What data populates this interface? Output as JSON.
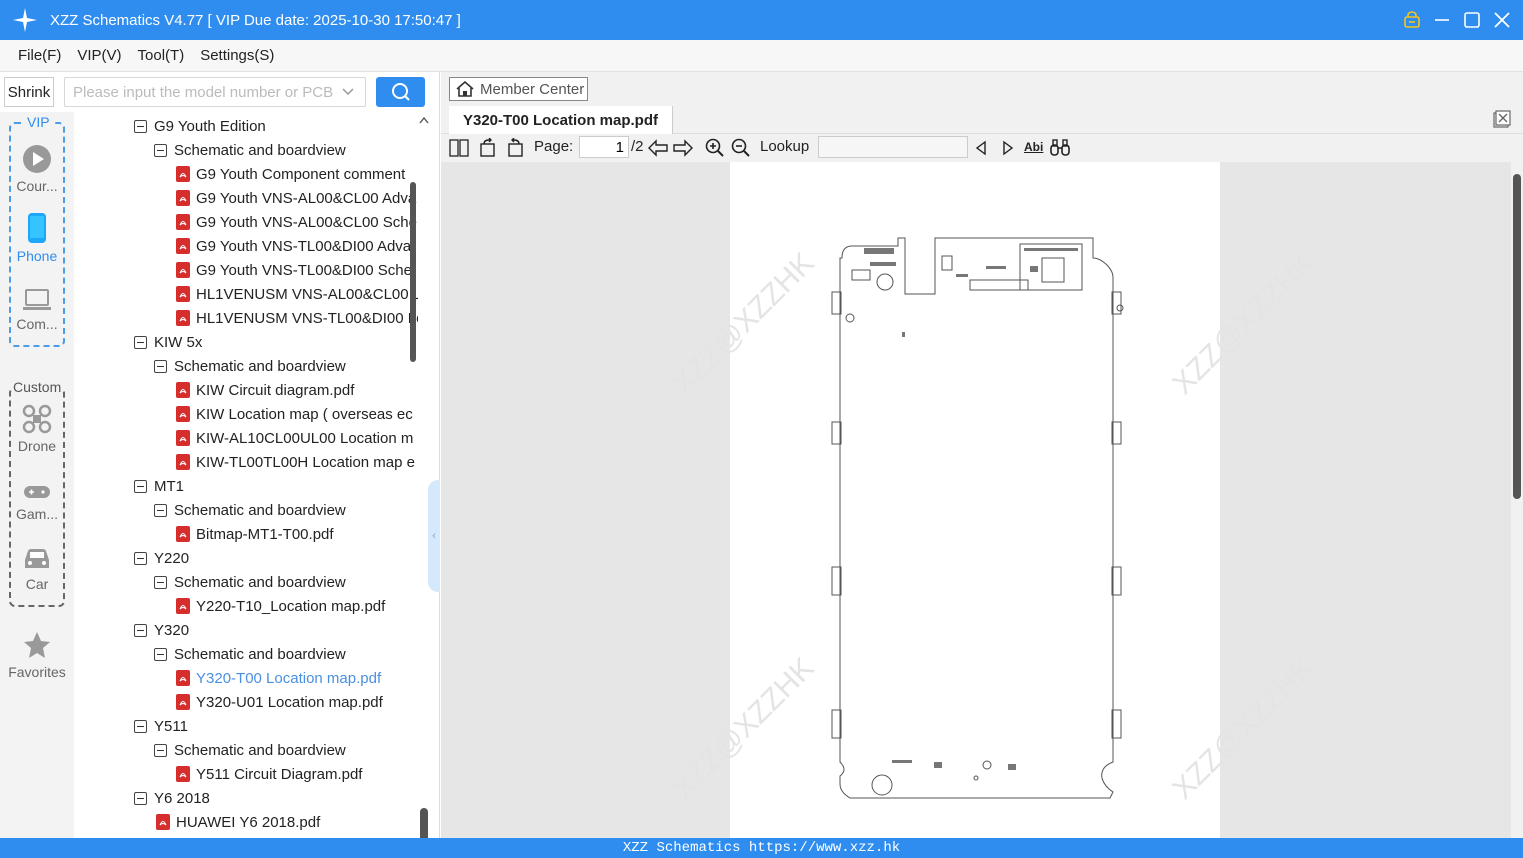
{
  "window": {
    "title": "XZZ Schematics V4.77 [ VIP Due date: 2025-10-30 17:50:47 ]",
    "icons": [
      "logo-icon",
      "lock-icon",
      "minimize-icon",
      "maximize-icon",
      "close-icon"
    ]
  },
  "menu": [
    "File(F)",
    "VIP(V)",
    "Tool(T)",
    "Settings(S)"
  ],
  "search": {
    "shrink_label": "Shrink",
    "placeholder": "Please input the model number or PCB"
  },
  "sidebar": {
    "vip_label": "VIP",
    "custom_label": "Custom",
    "items": [
      {
        "label": "Cour...",
        "icon": "play-icon"
      },
      {
        "label": "Phone",
        "icon": "phone-icon",
        "active": true
      },
      {
        "label": "Com...",
        "icon": "laptop-icon"
      },
      {
        "label": "Drone",
        "icon": "drone-icon"
      },
      {
        "label": "Gam...",
        "icon": "gamepad-icon"
      },
      {
        "label": "Car",
        "icon": "car-icon"
      },
      {
        "label": "Favorites",
        "icon": "star-icon"
      }
    ]
  },
  "tree": [
    {
      "level": 0,
      "type": "folder",
      "label": "G9 Youth Edition"
    },
    {
      "level": 1,
      "type": "folder",
      "label": "Schematic and boardview"
    },
    {
      "level": 2,
      "type": "pdf",
      "label": "G9 Youth Component comment"
    },
    {
      "level": 2,
      "type": "pdf",
      "label": "G9 Youth VNS-AL00&CL00 Adva"
    },
    {
      "level": 2,
      "type": "pdf",
      "label": "G9 Youth VNS-AL00&CL00 Sche"
    },
    {
      "level": 2,
      "type": "pdf",
      "label": "G9 Youth VNS-TL00&DI00 Adva"
    },
    {
      "level": 2,
      "type": "pdf",
      "label": "G9 Youth VNS-TL00&DI00 Sche"
    },
    {
      "level": 2,
      "type": "pdf",
      "label": "HL1VENUSM VNS-AL00&CL00 L"
    },
    {
      "level": 2,
      "type": "pdf",
      "label": "HL1VENUSM VNS-TL00&DI00 Lo"
    },
    {
      "level": 0,
      "type": "folder",
      "label": "KIW 5x"
    },
    {
      "level": 1,
      "type": "folder",
      "label": "Schematic and boardview"
    },
    {
      "level": 2,
      "type": "pdf",
      "label": "KIW Circuit diagram.pdf"
    },
    {
      "level": 2,
      "type": "pdf",
      "label": "KIW Location map ( overseas ec"
    },
    {
      "level": 2,
      "type": "pdf",
      "label": "KIW-AL10CL00UL00 Location m"
    },
    {
      "level": 2,
      "type": "pdf",
      "label": "KIW-TL00TL00H Location map e"
    },
    {
      "level": 0,
      "type": "folder",
      "label": "MT1"
    },
    {
      "level": 1,
      "type": "folder",
      "label": "Schematic and boardview"
    },
    {
      "level": 2,
      "type": "pdf",
      "label": "Bitmap-MT1-T00.pdf"
    },
    {
      "level": 0,
      "type": "folder",
      "label": "Y220"
    },
    {
      "level": 1,
      "type": "folder",
      "label": "Schematic and boardview"
    },
    {
      "level": 2,
      "type": "pdf",
      "label": "Y220-T10_Location map.pdf"
    },
    {
      "level": 0,
      "type": "folder",
      "label": "Y320"
    },
    {
      "level": 1,
      "type": "folder",
      "label": "Schematic and boardview"
    },
    {
      "level": 2,
      "type": "pdf",
      "label": "Y320-T00 Location map.pdf",
      "selected": true
    },
    {
      "level": 2,
      "type": "pdf",
      "label": "Y320-U01 Location map.pdf"
    },
    {
      "level": 0,
      "type": "folder",
      "label": "Y511"
    },
    {
      "level": 1,
      "type": "folder",
      "label": "Schematic and boardview"
    },
    {
      "level": 2,
      "type": "pdf",
      "label": "Y511 Circuit Diagram.pdf"
    },
    {
      "level": 0,
      "type": "folder",
      "label": "Y6 2018"
    },
    {
      "level": 1,
      "type": "pdf",
      "label": "HUAWEI Y6 2018.pdf"
    }
  ],
  "viewer": {
    "member_center": "Member Center",
    "tab_title": "Y320-T00 Location map.pdf",
    "page_label": "Page:",
    "page_current": "1",
    "page_total": "/2",
    "lookup_label": "Lookup",
    "abi_label": "Abi",
    "watermark": "XZZ@XZZHK"
  },
  "status": "XZZ Schematics https://www.xzz.hk",
  "colors": {
    "accent": "#2f8df0",
    "selected_text": "#4a90e2",
    "pdf_icon": "#d62d2d"
  }
}
